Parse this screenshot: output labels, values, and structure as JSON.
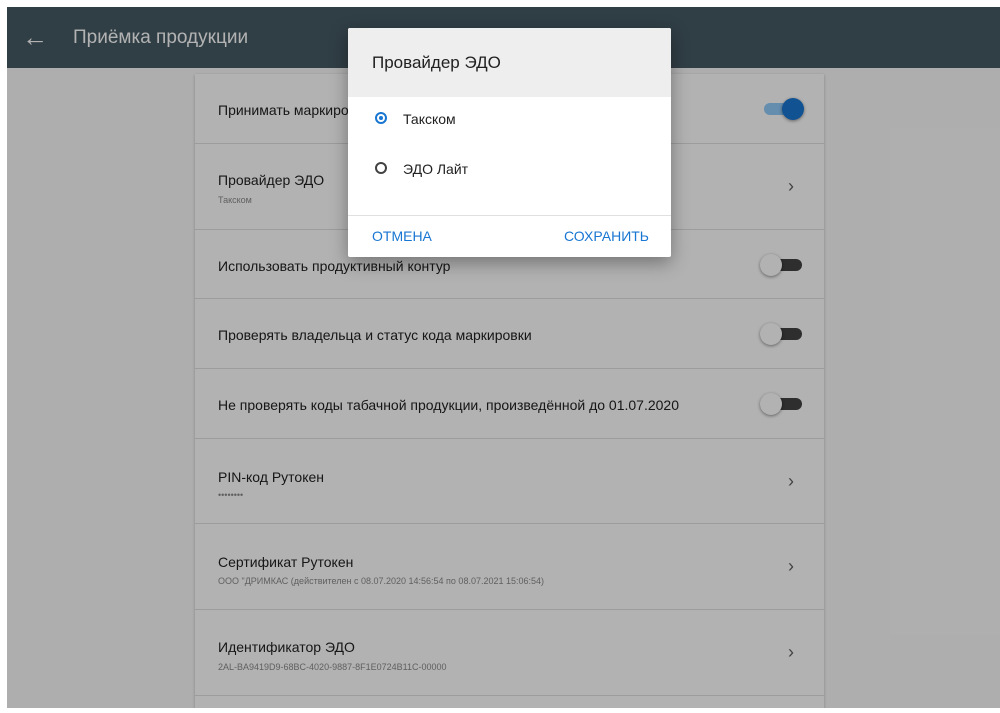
{
  "appbar": {
    "title": "Приёмка продукции"
  },
  "settings": {
    "accept_marked": {
      "title": "Принимать маркированную продукцию",
      "enabled": true
    },
    "edo_provider": {
      "title": "Провайдер ЭДО",
      "value": "Такском"
    },
    "productive_contour": {
      "title": "Использовать продуктивный контур",
      "enabled": false
    },
    "check_owner": {
      "title": "Проверять владельца и статус кода маркировки",
      "enabled": false
    },
    "skip_tobacco": {
      "title": "Не проверять коды табачной продукции, произведённой до 01.07.2020",
      "enabled": false
    },
    "pin": {
      "title": "PIN-код Рутокен",
      "value": "••••••••"
    },
    "certificate": {
      "title": "Сертификат Рутокен",
      "value": "ООО \"ДРИМКАС (действителен с 08.07.2020 14:56:54 по 08.07.2021 15:06:54)"
    },
    "edo_id": {
      "title": "Идентификатор ЭДО",
      "value": "2AL-BA9419D9-68BC-4020-9887-8F1E0724B11C-00000"
    }
  },
  "dialog": {
    "title": "Провайдер ЭДО",
    "options": [
      {
        "label": "Такском",
        "selected": true
      },
      {
        "label": "ЭДО Лайт",
        "selected": false
      }
    ],
    "cancel_label": "ОТМЕНА",
    "save_label": "СОХРАНИТЬ"
  },
  "icons": {
    "back": "arrow-left-icon",
    "chevron": "chevron-right-icon"
  },
  "colors": {
    "appbar": "#455a64",
    "accent": "#1976d2"
  }
}
